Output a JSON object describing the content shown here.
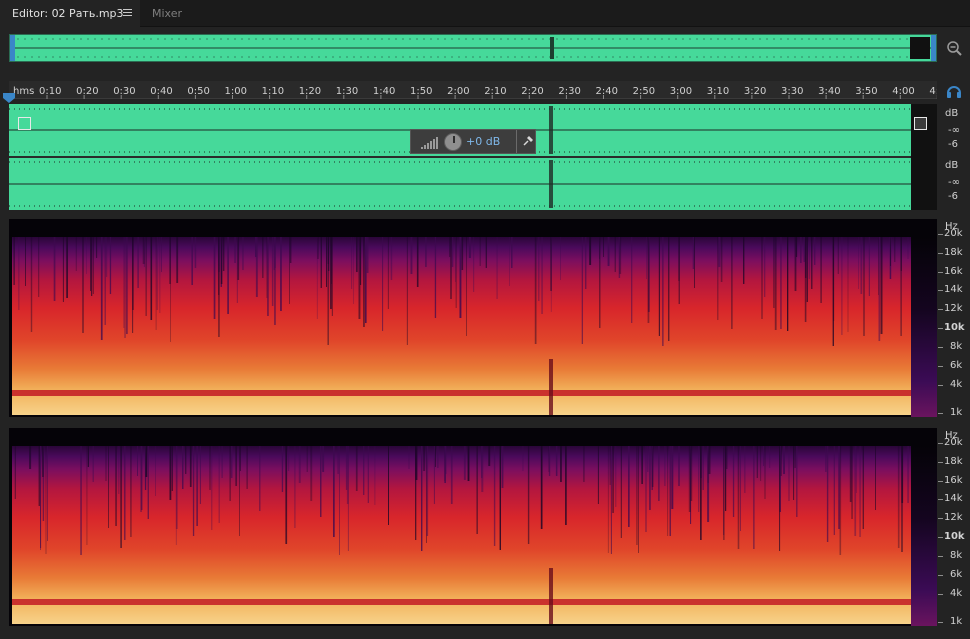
{
  "tabs": {
    "editor_label": "Editor: 02 Рать.mp3",
    "mixer_label": "Mixer"
  },
  "ruler": {
    "unit": "hms",
    "labels": [
      "0:10",
      "0:20",
      "0:30",
      "0:40",
      "0:50",
      "1:00",
      "1:10",
      "1:20",
      "1:30",
      "1:40",
      "1:50",
      "2:00",
      "2:10",
      "2:20",
      "2:30",
      "2:40",
      "2:50",
      "3:00",
      "3:10",
      "3:20",
      "3:30",
      "3:40",
      "3:50",
      "4:00",
      "4:"
    ]
  },
  "hud": {
    "volume_label": "+0 dB"
  },
  "amplitude_scale": {
    "ch1": [
      "dB",
      "-∞",
      "-6"
    ],
    "ch2": [
      "dB",
      "-∞",
      "-6"
    ]
  },
  "freq_scale": {
    "unit": "Hz",
    "labels": [
      "20k",
      "18k",
      "16k",
      "14k",
      "12k",
      "10k",
      "8k",
      "6k",
      "4k",
      "1k"
    ]
  },
  "colors": {
    "waveform": "#46d99a",
    "accent": "#3a86c8"
  }
}
